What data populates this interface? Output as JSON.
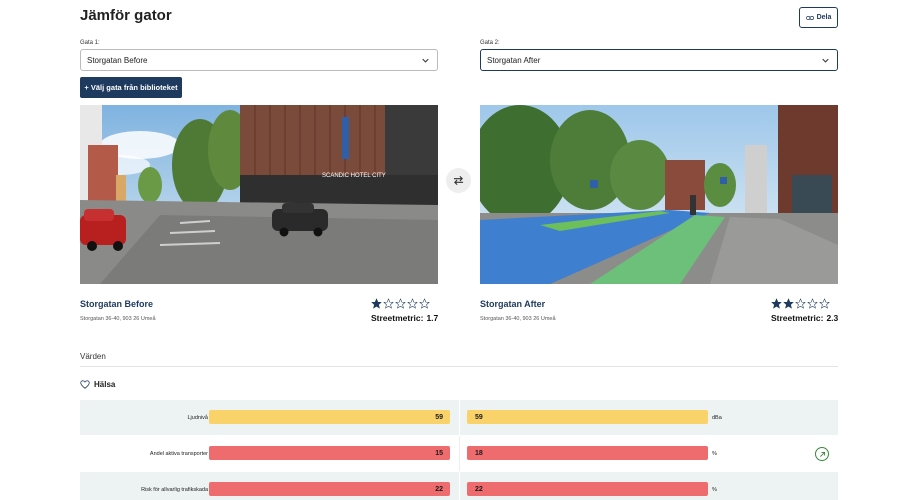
{
  "header": {
    "title": "Jämför gator",
    "share_label": "Dela"
  },
  "selectors": {
    "street1": {
      "label": "Gata 1:",
      "value": "Storgatan Before"
    },
    "street2": {
      "label": "Gata 2:",
      "value": "Storgatan After"
    }
  },
  "library_button": "+ Välj gata från biblioteket",
  "left": {
    "name": "Storgatan Before",
    "address": "Storgatan 36-40, 903 26 Umeå",
    "metric_label": "Streetmetric:",
    "metric_value": "1.7",
    "rating": 1,
    "sign_text": "SCANDIC HOTEL CITY"
  },
  "right": {
    "name": "Storgatan After",
    "address": "Storgatan 36-40, 903 26 Umeå",
    "metric_label": "Streetmetric:",
    "metric_value": "2.3",
    "rating": 2
  },
  "values_section": {
    "label": "Värden"
  },
  "category": {
    "name": "Hälsa",
    "icon": "heart-icon"
  },
  "rows": [
    {
      "label": "Ljudnivå",
      "left": "59",
      "right": "59",
      "unit": "dBa",
      "color": "#f9d26a",
      "trend": false
    },
    {
      "label": "Andel aktiva transporter",
      "left": "15",
      "right": "18",
      "unit": "%",
      "color": "#ee6b6e",
      "trend": true
    },
    {
      "label": "Risk för allvarlig trafikskada",
      "left": "22",
      "right": "22",
      "unit": "%",
      "color": "#ee6b6e",
      "trend": false
    }
  ],
  "colors": {
    "primary": "#1e3a5f",
    "star": "#1e3a5f",
    "trend_green": "#3a8a3a"
  }
}
